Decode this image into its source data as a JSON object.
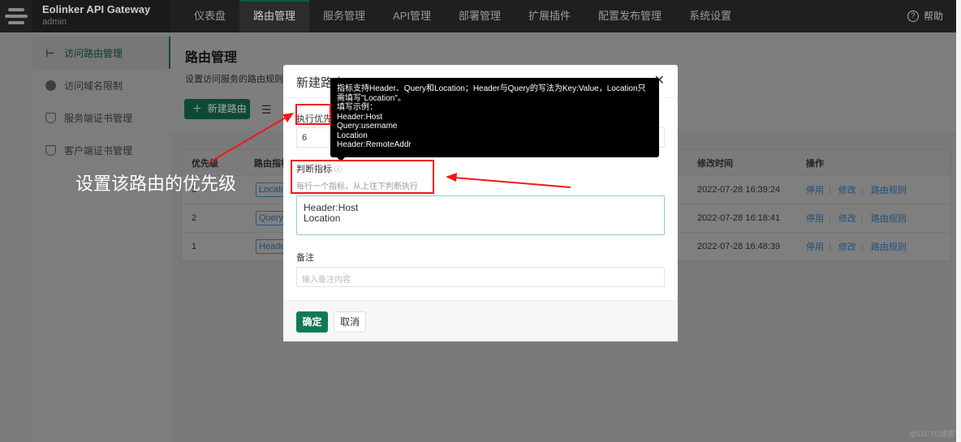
{
  "nav": {
    "brand": "Eolinker API Gateway",
    "user": "admin",
    "items": [
      "仪表盘",
      "路由管理",
      "服务管理",
      "API管理",
      "部署管理",
      "扩展插件",
      "配置发布管理",
      "系统设置"
    ],
    "active": "路由管理",
    "help": "帮助"
  },
  "sidebar": {
    "items": [
      {
        "label": "访问路由管理",
        "icon": "tree-icon",
        "active": true
      },
      {
        "label": "访问域名限制",
        "icon": "globe-icon"
      },
      {
        "label": "服务端证书管理",
        "icon": "shield-icon"
      },
      {
        "label": "客户端证书管理",
        "icon": "shield-icon"
      }
    ]
  },
  "main": {
    "title": "路由管理",
    "desc": "设置访问服务的路由规则",
    "new_button": "新建路由"
  },
  "table": {
    "headers": [
      "优先级",
      "路由指标",
      "修改时间",
      "操作"
    ],
    "rows": [
      {
        "priority": "3",
        "tag": "Location",
        "time": "2022-07-28 16:39:24"
      },
      {
        "priority": "2",
        "tag": "Query:",
        "time": "2022-07-28 16:18:41"
      },
      {
        "priority": "1",
        "tag": "Header",
        "time": "2022-07-28 16:48:39"
      }
    ],
    "actions": [
      "停用",
      "修改",
      "路由规则"
    ]
  },
  "modal": {
    "title": "新建路由",
    "priority_label": "执行优先级",
    "priority_value": "6",
    "indicator_label": "判断指标",
    "indicator_hint": "每行一个指标，从上往下判断执行",
    "indicator_value": "Header:Host\nLocation",
    "remark_label": "备注",
    "remark_placeholder": "输入备注内容",
    "ok": "确定",
    "cancel": "取消"
  },
  "tooltip": {
    "lines": [
      "指标支持Header、Query和Location；Header与Query的写法为Key:Value，Location只需填写\"Location\"。",
      "填写示例：",
      "Header:Host",
      "Query:username",
      "Location",
      "Header:RemoteAddr"
    ]
  },
  "annotation": {
    "text": "设置该路由的优先级",
    "color": "#f01818"
  },
  "watermark": "@51CTO博客",
  "colors": {
    "brand_green": "#0f7a58",
    "annotation_red": "#f01818"
  }
}
